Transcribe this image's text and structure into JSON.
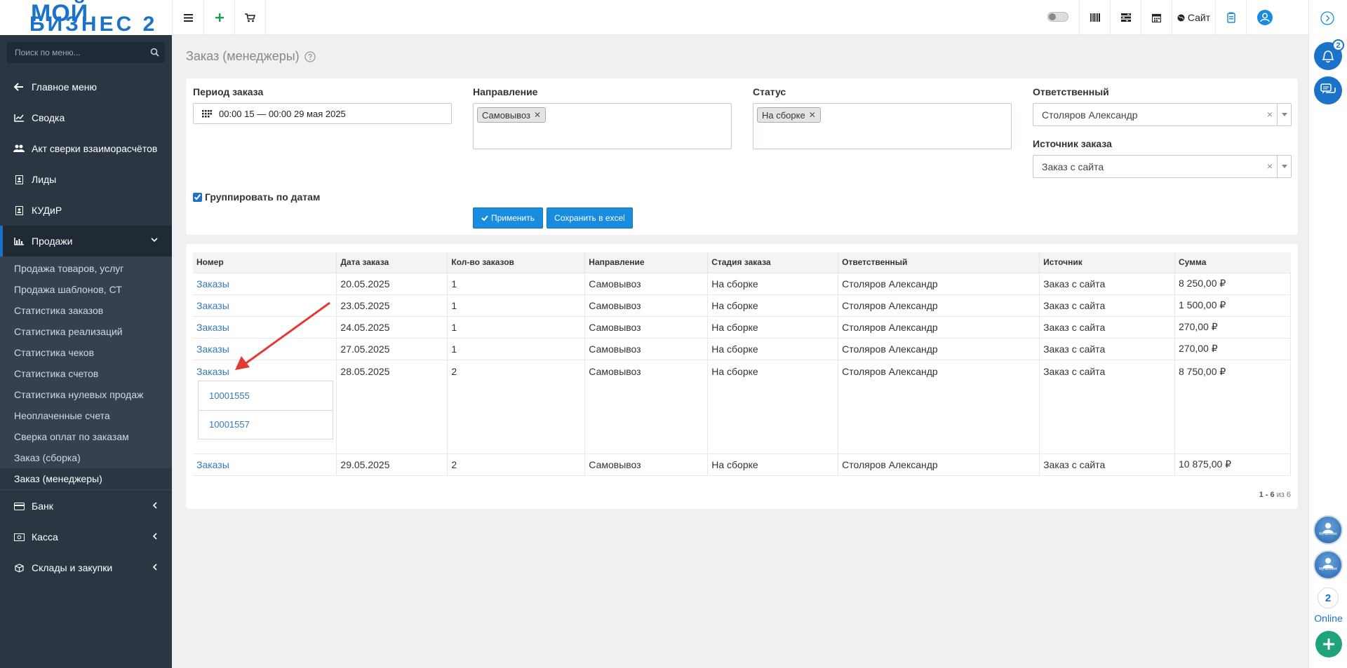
{
  "logo": {
    "line1": "МОЙ",
    "line2": "БИЗНЕС 2"
  },
  "sidebar": {
    "search_placeholder": "Поиск по меню...",
    "items": [
      {
        "label": "Главное меню",
        "icon": "arrow-left-icon"
      },
      {
        "label": "Сводка",
        "icon": "line-chart-icon"
      },
      {
        "label": "Акт сверки взаиморасчётов",
        "icon": "users-icon"
      },
      {
        "label": "Лиды",
        "icon": "contact-card-icon"
      },
      {
        "label": "КУДиР",
        "icon": "contact-card-icon"
      },
      {
        "label": "Продажи",
        "icon": "bar-chart-icon"
      }
    ],
    "sales_submenu": [
      "Продажа товаров, услуг",
      "Продажа шаблонов, СТ",
      "Статистика заказов",
      "Статистика реализаций",
      "Статистика чеков",
      "Статистика счетов",
      "Статистика нулевых продаж",
      "Неоплаченные счета",
      "Сверка оплат по заказам",
      "Заказ (сборка)",
      "Заказ (менеджеры)"
    ],
    "bottom_items": [
      {
        "label": "Банк",
        "icon": "credit-card-icon"
      },
      {
        "label": "Касса",
        "icon": "money-icon"
      },
      {
        "label": "Склады и закупки",
        "icon": "box-icon"
      }
    ]
  },
  "topbar": {
    "site_label": "Сайт"
  },
  "page": {
    "title": "Заказ (менеджеры)"
  },
  "filters": {
    "period_label": "Период заказа",
    "period_value": "00:00 15 — 00:00 29 мая 2025",
    "direction_label": "Направление",
    "direction_tag": "Самовывоз",
    "status_label": "Статус",
    "status_tag": "На сборке",
    "responsible_label": "Ответственный",
    "responsible_value": "Столяров Александр",
    "source_label": "Источник заказа",
    "source_value": "Заказ с сайта",
    "group_by_dates_label": "Группировать по датам",
    "apply_label": "Применить",
    "excel_label": "Сохранить в excel"
  },
  "table": {
    "headers": [
      "Номер",
      "Дата заказа",
      "Кол-во заказов",
      "Направление",
      "Стадия заказа",
      "Ответственный",
      "Источник",
      "Сумма"
    ],
    "rows": [
      [
        "Заказы",
        "20.05.2025",
        "1",
        "Самовывоз",
        "На сборке",
        "Столяров Александр",
        "Заказ с сайта",
        "8 250,00 ₽"
      ],
      [
        "Заказы",
        "23.05.2025",
        "1",
        "Самовывоз",
        "На сборке",
        "Столяров Александр",
        "Заказ с сайта",
        "1 500,00 ₽"
      ],
      [
        "Заказы",
        "24.05.2025",
        "1",
        "Самовывоз",
        "На сборке",
        "Столяров Александр",
        "Заказ с сайта",
        "270,00 ₽"
      ],
      [
        "Заказы",
        "27.05.2025",
        "1",
        "Самовывоз",
        "На сборке",
        "Столяров Александр",
        "Заказ с сайта",
        "270,00 ₽"
      ],
      [
        "Заказы",
        "28.05.2025",
        "2",
        "Самовывоз",
        "На сборке",
        "Столяров Александр",
        "Заказ с сайта",
        "8 750,00 ₽"
      ],
      [
        "Заказы",
        "29.05.2025",
        "2",
        "Самовывоз",
        "На сборке",
        "Столяров Александр",
        "Заказ с сайта",
        "10 875,00 ₽"
      ]
    ],
    "expanded_orders": [
      "10001555",
      "10001557"
    ],
    "pager_range": "1 - 6",
    "pager_of": " из 6"
  },
  "rail": {
    "notifications_count": "2",
    "account_caption": "My account",
    "online_count": "2",
    "online_label": "Online"
  },
  "colors": {
    "accent": "#1a73c8",
    "sidebar_bg": "#2b3643",
    "link": "#337ab7",
    "button": "#1a8ce0",
    "arrow": "#e53935"
  }
}
